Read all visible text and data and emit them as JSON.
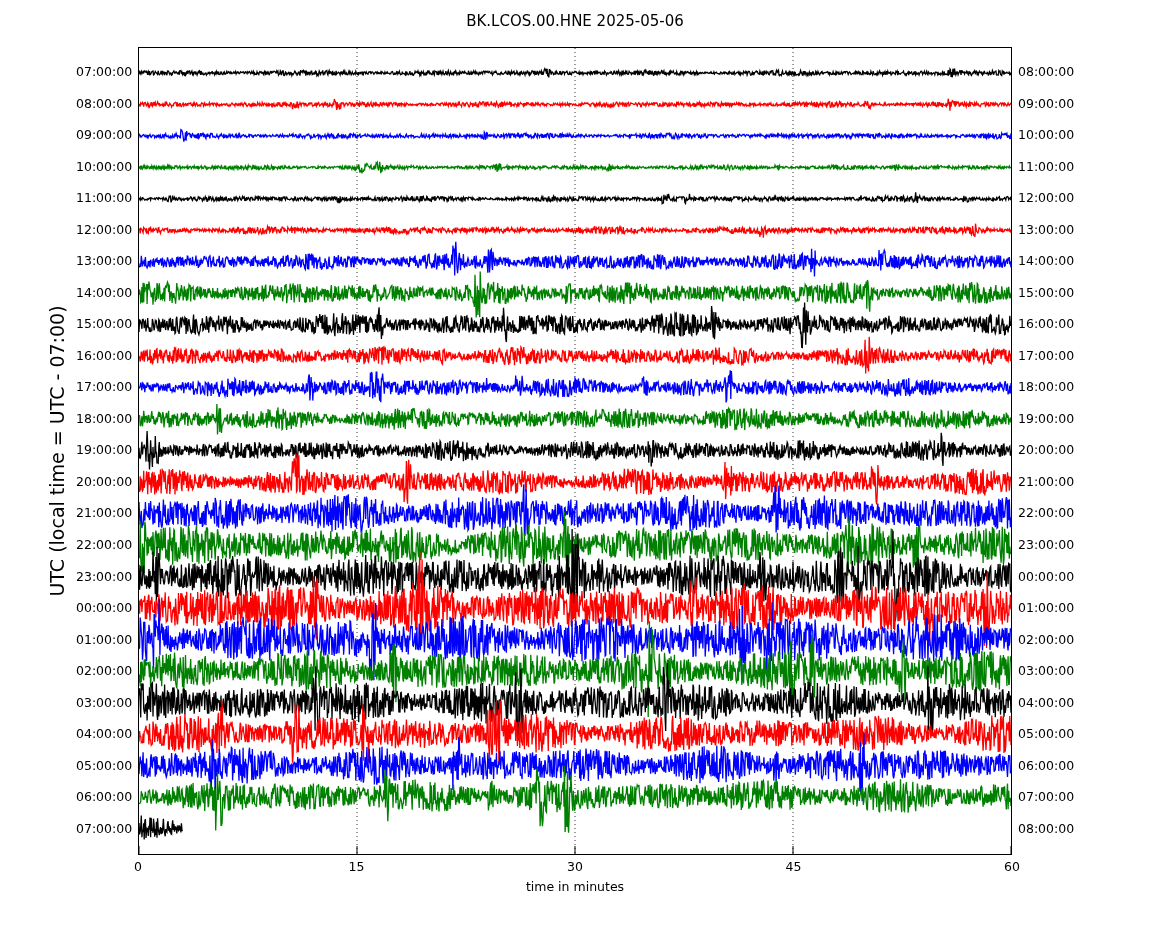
{
  "title": "BK.LCOS.00.HNE 2025-05-06",
  "plot": {
    "ylabel": "UTC (local time = UTC - 07:00)",
    "xlabel": "time in minutes",
    "xticks": [
      "0",
      "15",
      "30",
      "45",
      "60"
    ],
    "traces": [
      {
        "left_label": "07:00:00",
        "right_label": "08:00:00",
        "color": "#000000",
        "kind": "full"
      },
      {
        "left_label": "08:00:00",
        "right_label": "09:00:00",
        "color": "#ff0000",
        "kind": "full"
      },
      {
        "left_label": "09:00:00",
        "right_label": "10:00:00",
        "color": "#0000ff",
        "kind": "full"
      },
      {
        "left_label": "10:00:00",
        "right_label": "11:00:00",
        "color": "#008000",
        "kind": "full"
      },
      {
        "left_label": "11:00:00",
        "right_label": "12:00:00",
        "color": "#000000",
        "kind": "full"
      },
      {
        "left_label": "12:00:00",
        "right_label": "13:00:00",
        "color": "#ff0000",
        "kind": "full"
      },
      {
        "left_label": "13:00:00",
        "right_label": "14:00:00",
        "color": "#0000ff",
        "kind": "full"
      },
      {
        "left_label": "14:00:00",
        "right_label": "15:00:00",
        "color": "#008000",
        "kind": "full"
      },
      {
        "left_label": "15:00:00",
        "right_label": "16:00:00",
        "color": "#000000",
        "kind": "full"
      },
      {
        "left_label": "16:00:00",
        "right_label": "17:00:00",
        "color": "#ff0000",
        "kind": "full"
      },
      {
        "left_label": "17:00:00",
        "right_label": "18:00:00",
        "color": "#0000ff",
        "kind": "full"
      },
      {
        "left_label": "18:00:00",
        "right_label": "19:00:00",
        "color": "#008000",
        "kind": "full"
      },
      {
        "left_label": "19:00:00",
        "right_label": "20:00:00",
        "color": "#000000",
        "kind": "full"
      },
      {
        "left_label": "20:00:00",
        "right_label": "21:00:00",
        "color": "#ff0000",
        "kind": "full"
      },
      {
        "left_label": "21:00:00",
        "right_label": "22:00:00",
        "color": "#0000ff",
        "kind": "full"
      },
      {
        "left_label": "22:00:00",
        "right_label": "23:00:00",
        "color": "#008000",
        "kind": "full"
      },
      {
        "left_label": "23:00:00",
        "right_label": "00:00:00",
        "color": "#000000",
        "kind": "full"
      },
      {
        "left_label": "00:00:00",
        "right_label": "01:00:00",
        "color": "#ff0000",
        "kind": "full"
      },
      {
        "left_label": "01:00:00",
        "right_label": "02:00:00",
        "color": "#0000ff",
        "kind": "full"
      },
      {
        "left_label": "02:00:00",
        "right_label": "03:00:00",
        "color": "#008000",
        "kind": "full"
      },
      {
        "left_label": "03:00:00",
        "right_label": "04:00:00",
        "color": "#000000",
        "kind": "full"
      },
      {
        "left_label": "04:00:00",
        "right_label": "05:00:00",
        "color": "#ff0000",
        "kind": "full"
      },
      {
        "left_label": "05:00:00",
        "right_label": "06:00:00",
        "color": "#0000ff",
        "kind": "full"
      },
      {
        "left_label": "06:00:00",
        "right_label": "07:00:00",
        "color": "#008000",
        "kind": "full"
      },
      {
        "left_label": "07:00:00",
        "right_label": "08:00:00",
        "color": "#000000",
        "kind": "partial"
      }
    ]
  }
}
